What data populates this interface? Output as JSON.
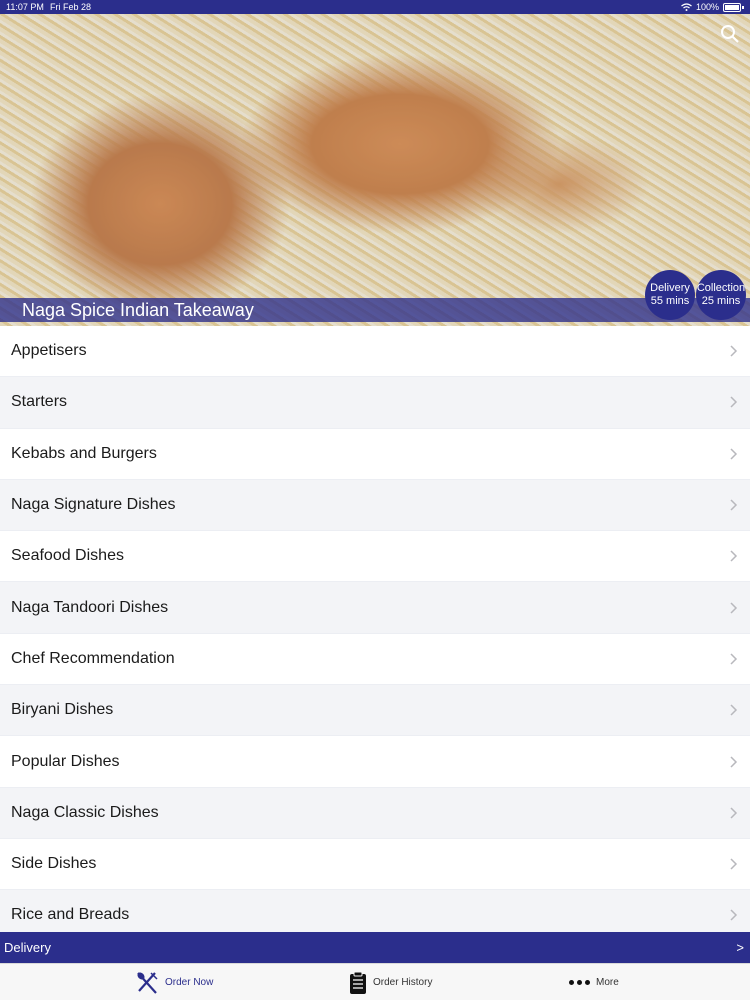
{
  "status_bar": {
    "time": "11:07 PM",
    "date": "Fri Feb 28",
    "battery": "100%"
  },
  "hero": {
    "title": "Naga Spice Indian Takeaway",
    "delivery": {
      "label": "Delivery",
      "time": "55 mins"
    },
    "collection": {
      "label": "Collection",
      "time": "25 mins"
    }
  },
  "menu": {
    "items": [
      {
        "label": "Appetisers"
      },
      {
        "label": "Starters"
      },
      {
        "label": "Kebabs and Burgers"
      },
      {
        "label": "Naga Signature Dishes"
      },
      {
        "label": "Seafood Dishes"
      },
      {
        "label": "Naga Tandoori Dishes"
      },
      {
        "label": "Chef Recommendation"
      },
      {
        "label": "Biryani Dishes"
      },
      {
        "label": "Popular Dishes"
      },
      {
        "label": "Naga Classic Dishes"
      },
      {
        "label": "Side Dishes"
      },
      {
        "label": "Rice and Breads"
      }
    ]
  },
  "delivery_bar": {
    "label": "Delivery",
    "arrow": ">"
  },
  "tabs": {
    "order_now": "Order Now",
    "order_history": "Order History",
    "more": "More"
  },
  "colors": {
    "brand": "#2b2e8c",
    "list_alt": "#f3f4f7"
  },
  "icons": [
    "wifi-icon",
    "battery-icon",
    "search-icon",
    "chevron-right-icon",
    "fork-knife-icon",
    "clipboard-icon",
    "more-dots-icon"
  ]
}
